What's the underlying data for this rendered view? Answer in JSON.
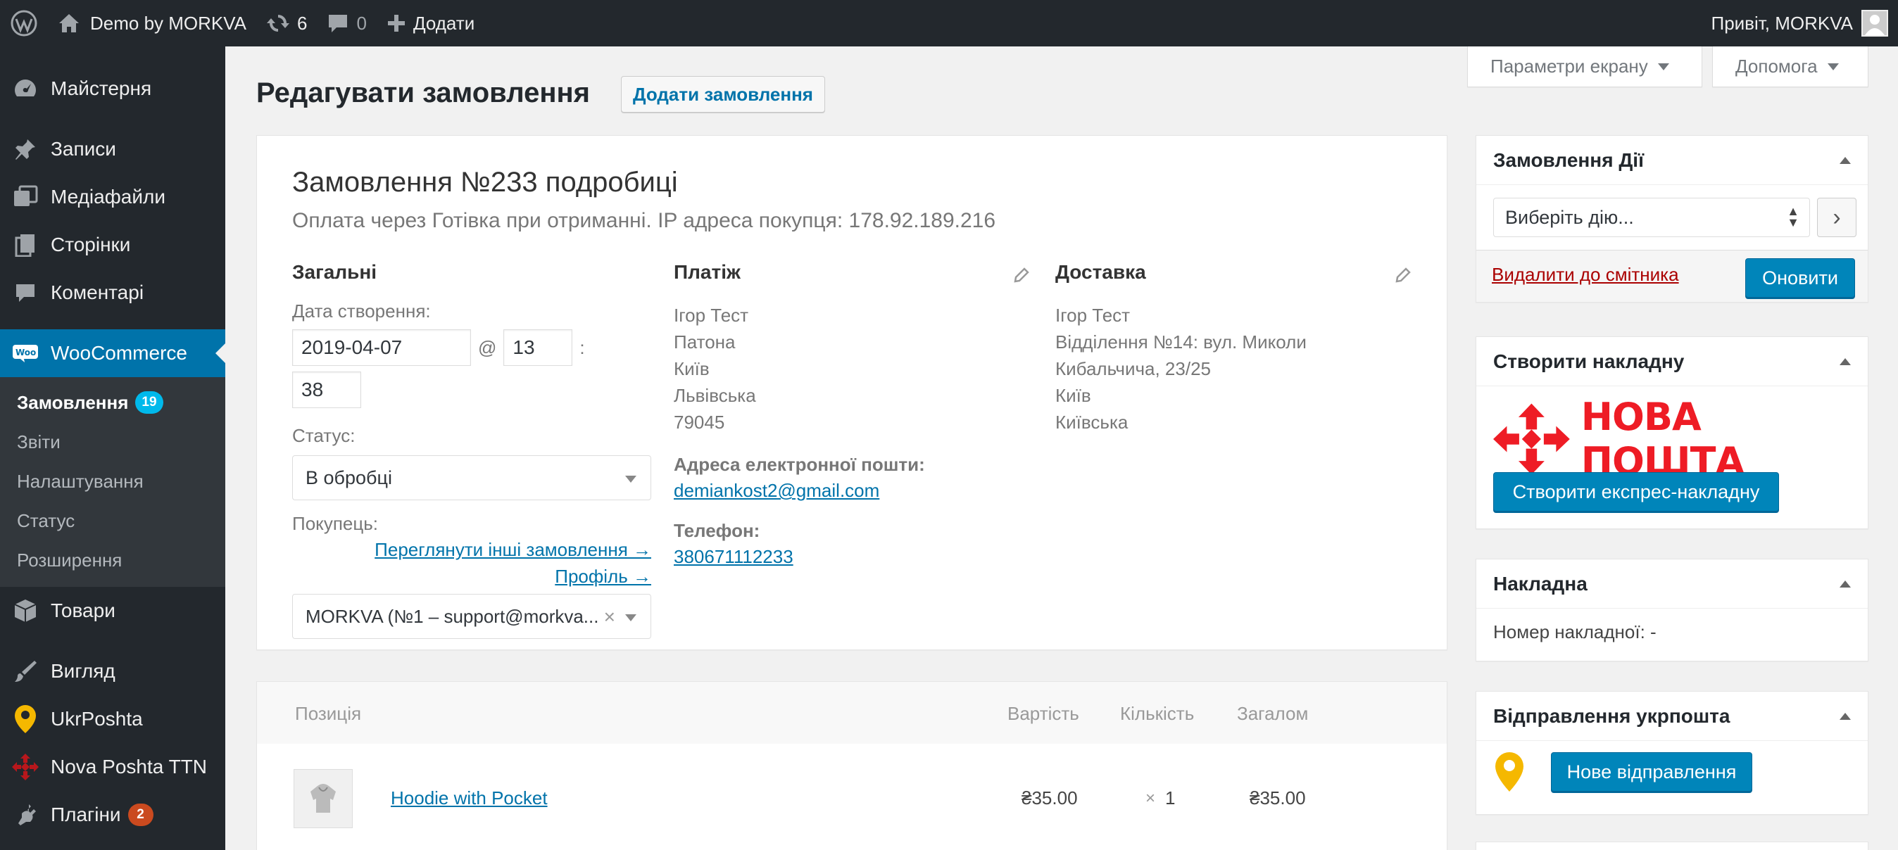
{
  "adminbar": {
    "site_name": "Demo by MORKVA",
    "updates_count": "6",
    "comments_count": "0",
    "new_label": "Додати",
    "greeting": "Привіт, MORKVA"
  },
  "sidebar": {
    "items": [
      {
        "label": "Майстерня",
        "icon": "dashboard-icon"
      },
      {
        "label": "Записи",
        "icon": "pin-icon"
      },
      {
        "label": "Медіафайли",
        "icon": "media-icon"
      },
      {
        "label": "Сторінки",
        "icon": "pages-icon"
      },
      {
        "label": "Коментарі",
        "icon": "comment-icon"
      },
      {
        "label": "WooCommerce",
        "icon": "woo-icon"
      },
      {
        "label": "Товари",
        "icon": "products-icon"
      },
      {
        "label": "Вигляд",
        "icon": "brush-icon"
      },
      {
        "label": "UkrPoshta",
        "icon": "ukrposhta-icon"
      },
      {
        "label": "Nova Poshta TTN",
        "icon": "novaposhta-icon"
      },
      {
        "label": "Плагіни",
        "icon": "plugin-icon",
        "badge": "2"
      }
    ],
    "woo_submenu": [
      {
        "label": "Замовлення",
        "badge": "19"
      },
      {
        "label": "Звіти"
      },
      {
        "label": "Налаштування"
      },
      {
        "label": "Статус"
      },
      {
        "label": "Розширення"
      }
    ]
  },
  "screen_options": {
    "label": "Параметри екрану"
  },
  "help": {
    "label": "Допомога"
  },
  "page": {
    "title": "Редагувати замовлення",
    "add_button": "Додати замовлення"
  },
  "order": {
    "heading": "Замовлення №233 подробиці",
    "subheading": "Оплата через Готівка при отриманні. IP адреса покупця: 178.92.189.216",
    "general": {
      "title": "Загальні",
      "date_label": "Дата створення:",
      "date": "2019-04-07",
      "at": "@",
      "hour": "13",
      "colon": ":",
      "minute": "38",
      "status_label": "Статус:",
      "status": "В обробці",
      "customer_label": "Покупець:",
      "other_orders_link": "Переглянути інші замовлення →",
      "profile_link": "Профіль →",
      "customer": "MORKVA (№1 – support@morkva..."
    },
    "billing": {
      "title": "Платіж",
      "lines": [
        "Ігор Тест",
        "Патона",
        "Київ",
        "Львівська",
        "79045"
      ],
      "email_label": "Адреса електронної пошти:",
      "email": "demiankost2@gmail.com",
      "phone_label": "Телефон:",
      "phone": "380671112233"
    },
    "shipping": {
      "title": "Доставка",
      "lines": [
        "Ігор Тест",
        "Відділення №14: вул. Миколи",
        "Кибальчича, 23/25",
        "Київ",
        "Київська"
      ]
    }
  },
  "items": {
    "headers": {
      "item": "Позиція",
      "cost": "Вартість",
      "qty": "Кількість",
      "total": "Загалом"
    },
    "rows": [
      {
        "name": "Hoodie with Pocket",
        "cost": "₴35.00",
        "qty_sign": "×",
        "qty": "1",
        "total": "₴35.00"
      }
    ]
  },
  "actions_box": {
    "title": "Замовлення Дії",
    "select": "Виберіть дію...",
    "go": "›",
    "trash": "Видалити до смітника",
    "update": "Оновити"
  },
  "np_box": {
    "title": "Створити накладну",
    "logo_text": "НОВА ПОШТА",
    "button": "Створити експрес-накладну"
  },
  "invoice_box": {
    "title": "Накладна",
    "number_label": "Номер накладної: -"
  },
  "ukr_box": {
    "title": "Відправлення укрпошта",
    "button": "Нове відправлення"
  },
  "colors": {
    "accent": "#0073aa",
    "admin_bg": "#23282d",
    "np_red": "#ee1c25",
    "ukr_yellow": "#f5b800",
    "trash_red": "#a00"
  }
}
